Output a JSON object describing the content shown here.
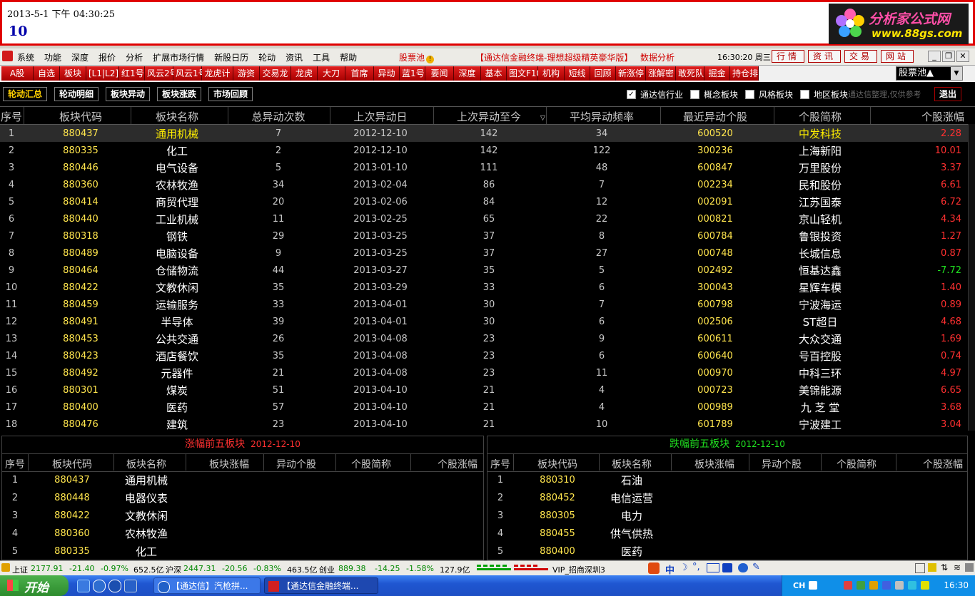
{
  "banner": {
    "datetime": "2013-5-1 下午 04:30:25",
    "number": "10",
    "logo_line1": "分析家公式网",
    "logo_line2": "www.88gs.com"
  },
  "menu": {
    "items": [
      "系统",
      "功能",
      "深度",
      "报价",
      "分析",
      "扩展市场行情",
      "新股日历",
      "轮动",
      "资讯",
      "工具",
      "帮助"
    ],
    "stock_pool": "股票池",
    "app_title": "【通达信金融终端-理想超级精英豪华版】",
    "data_analysis": "数据分析",
    "clock": "16:30:20 周三",
    "buttons": [
      "行情",
      "资讯",
      "交易",
      "网站"
    ]
  },
  "toolbar": {
    "buttons": [
      "A股",
      "自选",
      "板块",
      "[L1|L2]",
      "红1号",
      "风云2号",
      "风云1号",
      "龙虎计",
      "游资",
      "交易龙",
      "龙虎",
      "大刀",
      "首席",
      "异动",
      "蓝1号",
      "要闻",
      "深度",
      "基本",
      "图文F10",
      "机构",
      "短线",
      "回顾",
      "新涨停",
      "涨解密",
      "敢死队",
      "掘金",
      "持仓排"
    ],
    "select_value": "股票池▲"
  },
  "tabs": [
    "轮动汇总",
    "轮动明细",
    "板块异动",
    "板块涨跌",
    "市场回顾"
  ],
  "filters": [
    {
      "label": "通达信行业",
      "checked": true
    },
    {
      "label": "概念板块",
      "checked": false
    },
    {
      "label": "风格板块",
      "checked": false
    },
    {
      "label": "地区板块",
      "checked": false
    }
  ],
  "note": "通达信整理,仅供参考",
  "exit_label": "退出",
  "main_table": {
    "headers": [
      "序号",
      "板块代码",
      "板块名称",
      "总异动次数",
      "上次异动日",
      "上次异动至今",
      "平均异动频率",
      "最近异动个股",
      "个股简称",
      "个股涨幅"
    ],
    "rows": [
      [
        "1",
        "880437",
        "通用机械",
        "7",
        "2012-12-10",
        "142",
        "34",
        "600520",
        "中发科技",
        "2.28"
      ],
      [
        "2",
        "880335",
        "化工",
        "2",
        "2012-12-10",
        "142",
        "122",
        "300236",
        "上海新阳",
        "10.01"
      ],
      [
        "3",
        "880446",
        "电气设备",
        "5",
        "2013-01-10",
        "111",
        "48",
        "600847",
        "万里股份",
        "3.37"
      ],
      [
        "4",
        "880360",
        "农林牧渔",
        "34",
        "2013-02-04",
        "86",
        "7",
        "002234",
        "民和股份",
        "6.61"
      ],
      [
        "5",
        "880414",
        "商贸代理",
        "20",
        "2013-02-06",
        "84",
        "12",
        "002091",
        "江苏国泰",
        "6.72"
      ],
      [
        "6",
        "880440",
        "工业机械",
        "11",
        "2013-02-25",
        "65",
        "22",
        "000821",
        "京山轻机",
        "4.34"
      ],
      [
        "7",
        "880318",
        "钢铁",
        "29",
        "2013-03-25",
        "37",
        "8",
        "600784",
        "鲁银投资",
        "1.27"
      ],
      [
        "8",
        "880489",
        "电脑设备",
        "9",
        "2013-03-25",
        "37",
        "27",
        "000748",
        "长城信息",
        "0.87"
      ],
      [
        "9",
        "880464",
        "仓储物流",
        "44",
        "2013-03-27",
        "35",
        "5",
        "002492",
        "恒基达鑫",
        "-7.72"
      ],
      [
        "10",
        "880422",
        "文教休闲",
        "35",
        "2013-03-29",
        "33",
        "6",
        "300043",
        "星辉车模",
        "1.40"
      ],
      [
        "11",
        "880459",
        "运输服务",
        "33",
        "2013-04-01",
        "30",
        "7",
        "600798",
        "宁波海运",
        "0.89"
      ],
      [
        "12",
        "880491",
        "半导体",
        "39",
        "2013-04-01",
        "30",
        "6",
        "002506",
        "ST超日",
        "4.68"
      ],
      [
        "13",
        "880453",
        "公共交通",
        "26",
        "2013-04-08",
        "23",
        "9",
        "600611",
        "大众交通",
        "1.69"
      ],
      [
        "14",
        "880423",
        "酒店餐饮",
        "35",
        "2013-04-08",
        "23",
        "6",
        "600640",
        "号百控股",
        "0.74"
      ],
      [
        "15",
        "880492",
        "元器件",
        "21",
        "2013-04-08",
        "23",
        "11",
        "000970",
        "中科三环",
        "4.97"
      ],
      [
        "16",
        "880301",
        "煤炭",
        "51",
        "2013-04-10",
        "21",
        "4",
        "000723",
        "美锦能源",
        "6.65"
      ],
      [
        "17",
        "880400",
        "医药",
        "57",
        "2013-04-10",
        "21",
        "4",
        "000989",
        "九 芝 堂",
        "3.68"
      ],
      [
        "18",
        "880476",
        "建筑",
        "23",
        "2013-04-10",
        "21",
        "10",
        "601789",
        "宁波建工",
        "3.04"
      ]
    ]
  },
  "top5": {
    "title": "涨幅前五板块",
    "date": "2012-12-10",
    "headers": [
      "序号",
      "板块代码",
      "板块名称",
      "板块涨幅",
      "异动个股",
      "个股简称",
      "个股涨幅"
    ],
    "rows": [
      [
        "1",
        "880437",
        "通用机械"
      ],
      [
        "2",
        "880448",
        "电器仪表"
      ],
      [
        "3",
        "880422",
        "文教休闲"
      ],
      [
        "4",
        "880360",
        "农林牧渔"
      ],
      [
        "5",
        "880335",
        "化工"
      ]
    ]
  },
  "bottom5": {
    "title": "跌幅前五板块",
    "date": "2012-12-10",
    "headers": [
      "序号",
      "板块代码",
      "板块名称",
      "板块涨幅",
      "异动个股",
      "个股简称",
      "个股涨幅"
    ],
    "rows": [
      [
        "1",
        "880310",
        "石油"
      ],
      [
        "2",
        "880452",
        "电信运营"
      ],
      [
        "3",
        "880305",
        "电力"
      ],
      [
        "4",
        "880455",
        "供气供热"
      ],
      [
        "5",
        "880400",
        "医药"
      ]
    ]
  },
  "status": {
    "sh_label": "上证",
    "sh_index": "2177.91",
    "sh_chg": "-21.40",
    "sh_pct": "-0.97%",
    "sh_amt": "652.5亿",
    "hs_label": "沪深",
    "hs_index": "2447.31",
    "hs_chg": "-20.56",
    "hs_pct": "-0.83%",
    "hs_amt": "463.5亿",
    "cy_label": "创业",
    "cy_index": "889.38",
    "cy_chg": "-14.25",
    "cy_pct": "-1.58%",
    "cy_amt": "127.9亿",
    "server": "VIP_招商深圳3",
    "ime": "中"
  },
  "taskbar": {
    "start": "开始",
    "tasks": [
      "【通达信】汽枪拼...",
      "【通达信金融终端..."
    ],
    "lang": "CH",
    "time": "16:30"
  },
  "colors": {
    "accent_red": "#d00000",
    "up_red": "#ff3030",
    "down_green": "#20e020",
    "code_yellow": "#ffe54d"
  }
}
